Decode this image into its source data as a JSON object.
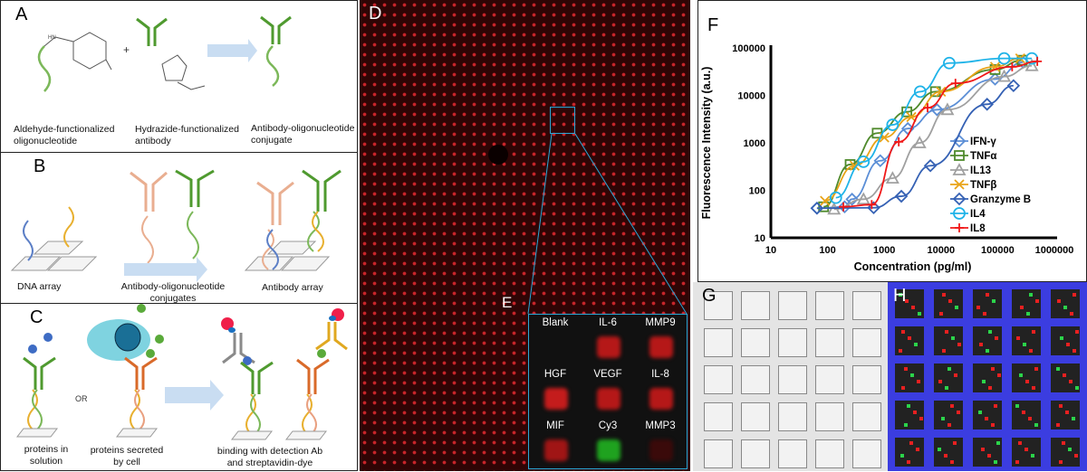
{
  "panels": {
    "A": {
      "label": "A",
      "captions": [
        "Aldehyde-functionalized oligonucleotide",
        "Hydrazide-functionalized antibody",
        "Antibody-oligonucleotide conjugate"
      ],
      "plus": "+"
    },
    "B": {
      "label": "B",
      "captions": [
        "DNA array",
        "Antibody-oligonucleotide conjugates",
        "Antibody array"
      ]
    },
    "C": {
      "label": "C",
      "captions": [
        "proteins in solution",
        "proteins secreted by cell",
        "binding with detection Ab and streptavidin-dye"
      ],
      "or": "OR"
    },
    "D": {
      "label": "D"
    },
    "E": {
      "label": "E",
      "cells": [
        {
          "name": "Blank",
          "color": ""
        },
        {
          "name": "IL-6",
          "color": "#b51818"
        },
        {
          "name": "MMP9",
          "color": "#b51818"
        },
        {
          "name": "HGF",
          "color": "#c41c1c"
        },
        {
          "name": "VEGF",
          "color": "#b51818"
        },
        {
          "name": "IL-8",
          "color": "#b51818"
        },
        {
          "name": "MIF",
          "color": "#a01515"
        },
        {
          "name": "Cy3",
          "color": "#1fa21f"
        },
        {
          "name": "MMP3",
          "color": "#3a0a0a"
        }
      ]
    },
    "G": {
      "label": "G"
    },
    "H": {
      "label": "H"
    },
    "F": {
      "label": "F"
    }
  },
  "chart_data": {
    "type": "line",
    "title": "",
    "xlabel": "Concentration (pg/ml)",
    "ylabel": "Fluorescence Intensity (a.u.)",
    "xscale": "log",
    "yscale": "log",
    "xlim": [
      10,
      1000000
    ],
    "ylim": [
      10,
      100000
    ],
    "xticks": [
      "10",
      "100",
      "1000",
      "10000",
      "100000",
      "1000000"
    ],
    "yticks": [
      "10",
      "100",
      "1000",
      "10000",
      "100000"
    ],
    "legend": "right",
    "series": [
      {
        "name": "IFN-γ",
        "color": "#5b8ed6",
        "marker": "diamond-open",
        "points": [
          [
            65,
            42
          ],
          [
            200,
            45
          ],
          [
            270,
            65
          ],
          [
            850,
            420
          ],
          [
            2600,
            2000
          ],
          [
            8500,
            5000
          ],
          [
            90000,
            22000
          ],
          [
            280000,
            50000
          ]
        ]
      },
      {
        "name": "TNFα",
        "color": "#4f8a2c",
        "marker": "square-open",
        "points": [
          [
            85,
            45
          ],
          [
            250,
            350
          ],
          [
            750,
            1600
          ],
          [
            2500,
            4500
          ],
          [
            8000,
            12000
          ],
          [
            90000,
            35000
          ],
          [
            270000,
            55000
          ]
        ]
      },
      {
        "name": "IL13",
        "color": "#a0a0a0",
        "marker": "triangle-open",
        "points": [
          [
            130,
            40
          ],
          [
            430,
            65
          ],
          [
            1400,
            180
          ],
          [
            4200,
            1000
          ],
          [
            13000,
            5000
          ],
          [
            130000,
            25000
          ],
          [
            400000,
            42000
          ]
        ]
      },
      {
        "name": "TNFβ",
        "color": "#e8a317",
        "marker": "x",
        "points": [
          [
            90,
            60
          ],
          [
            300,
            330
          ],
          [
            1000,
            1300
          ],
          [
            3000,
            3500
          ],
          [
            10000,
            12000
          ],
          [
            90000,
            40000
          ],
          [
            250000,
            60000
          ]
        ]
      },
      {
        "name": "Granzyme B",
        "color": "#3561b4",
        "marker": "diamond-open",
        "points": [
          [
            65,
            42
          ],
          [
            650,
            43
          ],
          [
            2000,
            75
          ],
          [
            6500,
            330
          ],
          [
            65000,
            6500
          ],
          [
            190000,
            16000
          ]
        ]
      },
      {
        "name": "IL4",
        "color": "#1fb3e8",
        "marker": "circle-open",
        "points": [
          [
            140,
            70
          ],
          [
            430,
            400
          ],
          [
            1400,
            2400
          ],
          [
            4300,
            12000
          ],
          [
            14000,
            48000
          ],
          [
            130000,
            60000
          ],
          [
            400000,
            60000
          ]
        ]
      },
      {
        "name": "IL8",
        "color": "#f01818",
        "marker": "plus",
        "points": [
          [
            190,
            45
          ],
          [
            600,
            50
          ],
          [
            1800,
            1050
          ],
          [
            5800,
            5500
          ],
          [
            18000,
            18000
          ],
          [
            180000,
            40000
          ],
          [
            500000,
            52000
          ]
        ]
      }
    ]
  }
}
